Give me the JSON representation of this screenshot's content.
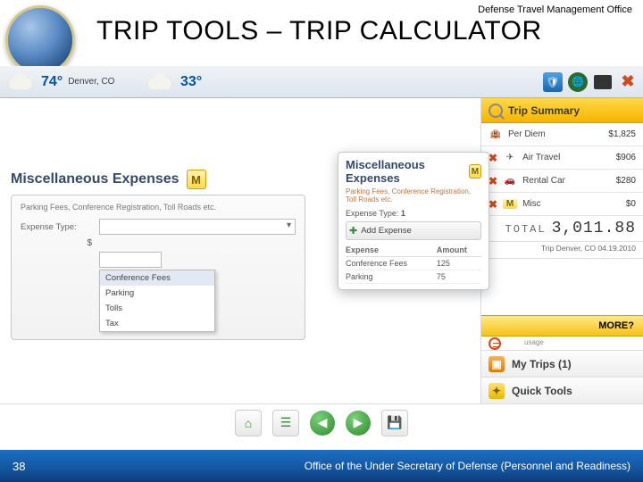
{
  "header": {
    "org": "Defense Travel Management Office",
    "title": "TRIP TOOLS – TRIP CALCULATOR"
  },
  "weather": [
    {
      "temp": "74°",
      "city": "Denver, CO"
    },
    {
      "temp": "33°",
      "city": ""
    }
  ],
  "main": {
    "section_title": "Miscellaneous Expenses",
    "m_badge": "M",
    "panel": {
      "desc": "Parking Fees, Conference Registration, Toll Roads etc.",
      "label_type": "Expense Type:",
      "currency": "$",
      "options": {
        "o0": "Conference Fees",
        "o1": "Parking",
        "o2": "Tolls",
        "o3": "Tax"
      }
    }
  },
  "popup": {
    "title": "Miscellaneous Expenses",
    "m_badge": "M",
    "hint": "Parking Fees, Conference Registration, Toll Roads etc.",
    "label_type": "Expense Type:",
    "step": "1",
    "add_label": "Add Expense",
    "col_expense": "Expense",
    "col_amount": "Amount",
    "rows": {
      "r0": {
        "name": "Conference Fees",
        "amount": "125"
      },
      "r1": {
        "name": "Parking",
        "amount": "75"
      }
    }
  },
  "summary": {
    "header": "Trip Summary",
    "rows": {
      "r0": {
        "icon": "🏨",
        "label": "Per Diem",
        "amount": "$1,825",
        "removable": false
      },
      "r1": {
        "icon": "✈",
        "label": "Air Travel",
        "amount": "$906",
        "removable": true
      },
      "r2": {
        "icon": "🚗",
        "label": "Rental Car",
        "amount": "$280",
        "removable": true
      },
      "r3": {
        "icon": "M",
        "label": "Misc",
        "amount": "$0",
        "removable": true
      }
    },
    "total_label": "TOTAL",
    "total_value": "3,011.88",
    "trip_meta": "Trip Denver, CO   04.19.2010"
  },
  "side": {
    "more": "MORE?",
    "usage": "usage",
    "my_trips": "My Trips (1)",
    "quick_tools": "Quick Tools"
  },
  "footer": {
    "page": "38",
    "text": "Office of the Under Secretary of Defense (Personnel and Readiness)"
  }
}
